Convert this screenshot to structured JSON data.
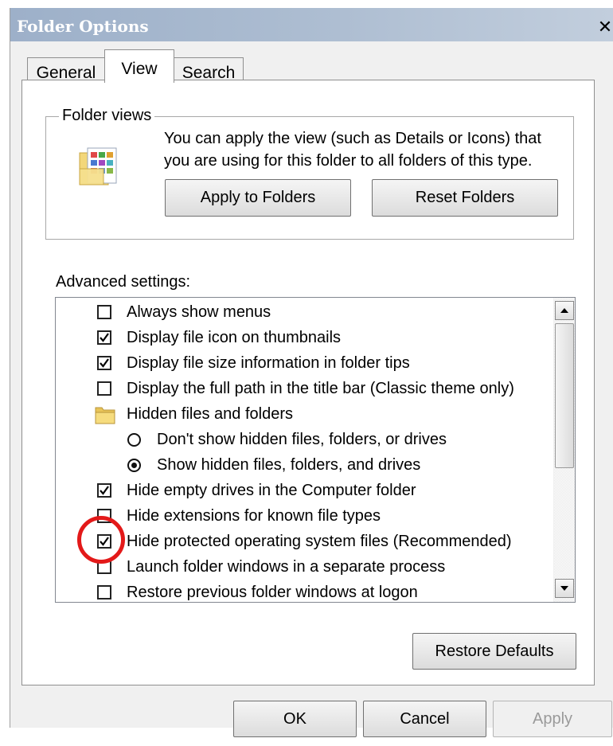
{
  "window": {
    "title": "Folder Options",
    "close_glyph": "✕"
  },
  "tabs": [
    {
      "label": "General",
      "active": false
    },
    {
      "label": "View",
      "active": true
    },
    {
      "label": "Search",
      "active": false
    }
  ],
  "folder_views": {
    "legend": "Folder views",
    "description": "You can apply the view (such as Details or Icons) that you are using for this folder to all folders of this type.",
    "icon": "folder-view-icon",
    "apply_button": "Apply to Folders",
    "reset_button": "Reset Folders"
  },
  "advanced": {
    "label": "Advanced settings:",
    "items": [
      {
        "type": "checkbox",
        "checked": false,
        "label": "Always show menus"
      },
      {
        "type": "checkbox",
        "checked": true,
        "label": "Display file icon on thumbnails"
      },
      {
        "type": "checkbox",
        "checked": true,
        "label": "Display file size information in folder tips"
      },
      {
        "type": "checkbox",
        "checked": false,
        "label": "Display the full path in the title bar (Classic theme only)"
      },
      {
        "type": "folder",
        "label": "Hidden files and folders",
        "icon": "folder-icon"
      },
      {
        "type": "radio",
        "checked": false,
        "label": "Don't show hidden files, folders, or drives"
      },
      {
        "type": "radio",
        "checked": true,
        "label": "Show hidden files, folders, and drives"
      },
      {
        "type": "checkbox",
        "checked": true,
        "label": "Hide empty drives in the Computer folder"
      },
      {
        "type": "checkbox",
        "checked": false,
        "label": "Hide extensions for known file types"
      },
      {
        "type": "checkbox",
        "checked": true,
        "label": "Hide protected operating system files (Recommended)",
        "highlighted": true
      },
      {
        "type": "checkbox",
        "checked": false,
        "label": "Launch folder windows in a separate process"
      },
      {
        "type": "checkbox",
        "checked": false,
        "label": "Restore previous folder windows at logon"
      }
    ],
    "restore_button": "Restore Defaults"
  },
  "footer": {
    "ok": "OK",
    "cancel": "Cancel",
    "apply": "Apply"
  },
  "colors": {
    "highlight_circle": "#e31919",
    "titlebar": "#9db0c9"
  }
}
